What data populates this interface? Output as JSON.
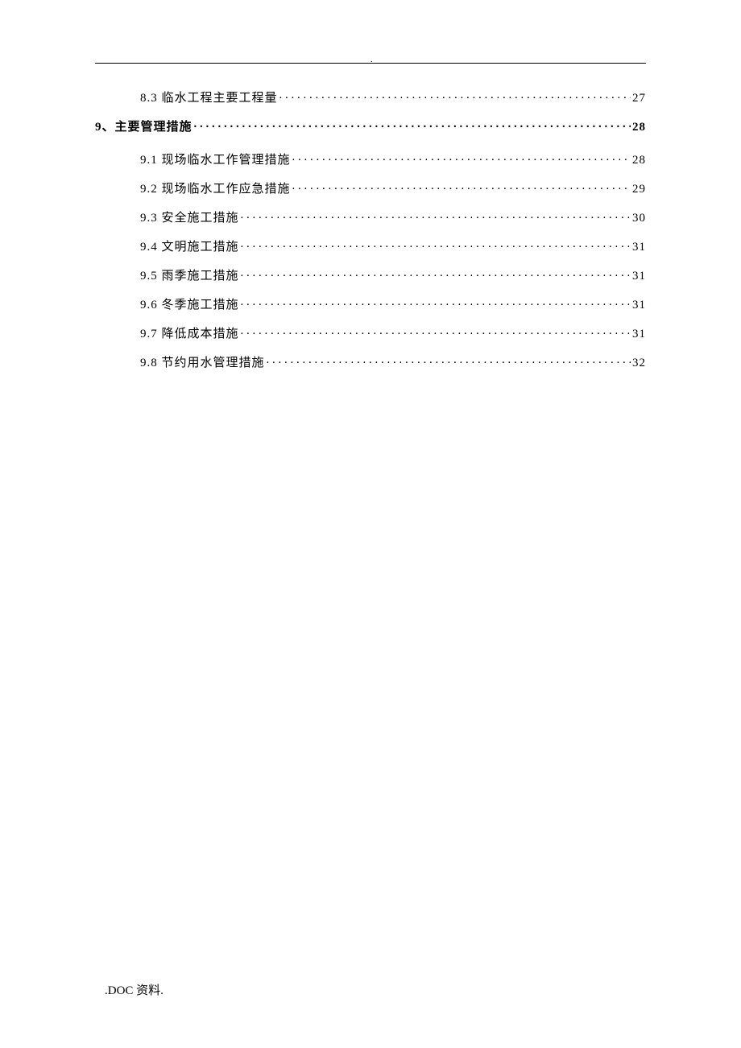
{
  "header_dot": ".",
  "toc": [
    {
      "level": 2,
      "label": "8.3 临水工程主要工程量",
      "page": "27"
    },
    {
      "level": 1,
      "label": "9、主要管理措施",
      "page": "28"
    },
    {
      "level": 2,
      "label": "9.1 现场临水工作管理措施",
      "page": "28"
    },
    {
      "level": 2,
      "label": "9.2 现场临水工作应急措施",
      "page": "29"
    },
    {
      "level": 2,
      "label": "9.3 安全施工措施",
      "page": "30"
    },
    {
      "level": 2,
      "label": "9.4 文明施工措施",
      "page": "31"
    },
    {
      "level": 2,
      "label": "9.5 雨季施工措施",
      "page": "31"
    },
    {
      "level": 2,
      "label": "9.6 冬季施工措施",
      "page": "31"
    },
    {
      "level": 2,
      "label": "9.7 降低成本措施",
      "page": "31"
    },
    {
      "level": 2,
      "label": "9.8 节约用水管理措施",
      "page": "32"
    }
  ],
  "footer": ".DOC 资料."
}
